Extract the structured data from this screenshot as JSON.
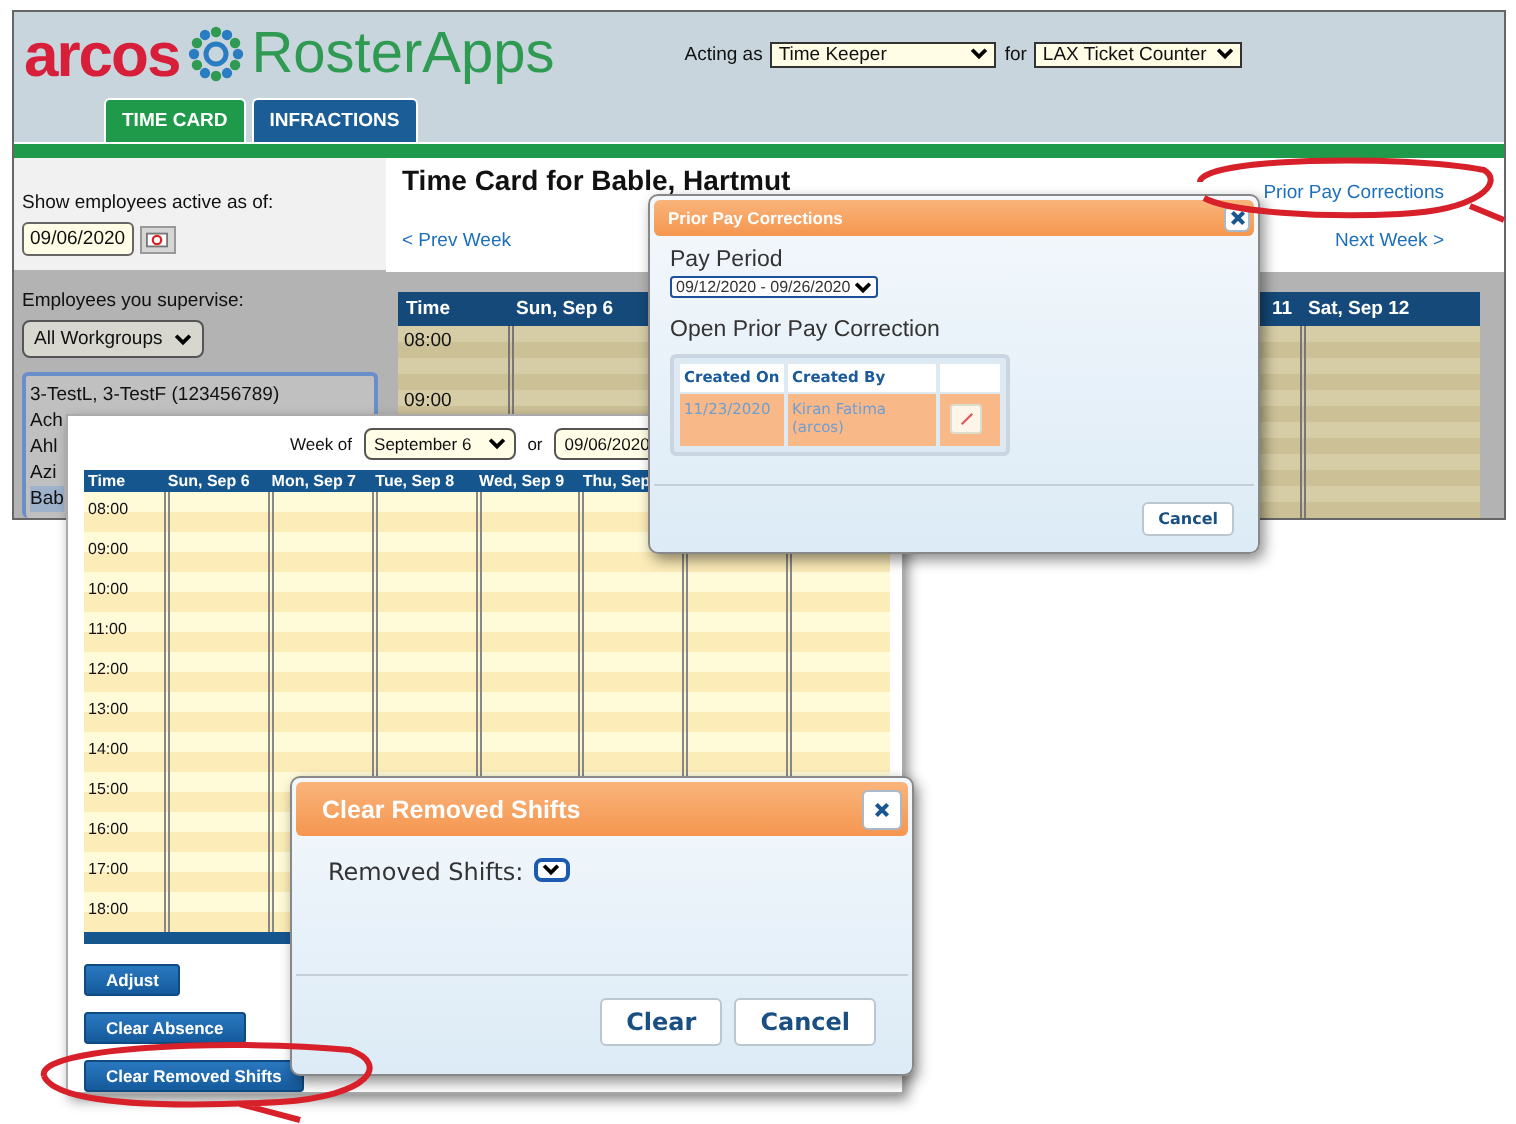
{
  "header": {
    "logo_word": "arcos",
    "logo_product": "RosterApps",
    "acting_as_label": "Acting as",
    "role": "Time Keeper",
    "for_label": "for",
    "location": "LAX Ticket Counter"
  },
  "tabs": [
    {
      "label": "TIME CARD",
      "selected": true
    },
    {
      "label": "INFRACTIONS",
      "selected": false
    }
  ],
  "sidebar": {
    "active_label": "Show employees active as of:",
    "active_date": "09/06/2020",
    "supervise_label": "Employees you supervise:",
    "workgroup": "All Workgroups",
    "employees": [
      {
        "name": "3-TestL, 3-TestF (123456789)",
        "selected": false
      },
      {
        "name": "Ach",
        "selected": false
      },
      {
        "name": "Ahl",
        "selected": false
      },
      {
        "name": "Azi",
        "selected": false
      },
      {
        "name": "Bab",
        "selected": true
      }
    ]
  },
  "time_card": {
    "title": "Time Card for Bable, Hartmut",
    "prev_link": "< Prev Week",
    "prior_link": "Prior Pay Corrections",
    "next_link": "Next Week >",
    "columns": [
      "Time",
      "Sun, Sep 6"
    ],
    "right_columns": [
      "11",
      "Sat, Sep 12"
    ],
    "hours": [
      "08:00",
      "09:00"
    ]
  },
  "week_view": {
    "week_of_label": "Week of",
    "week": "September 6",
    "or_label": "or",
    "date": "09/06/2020",
    "columns": [
      "Time",
      "Sun, Sep 6",
      "Mon, Sep 7",
      "Tue, Sep 8",
      "Wed, Sep 9",
      "Thu, Sep"
    ],
    "hours": [
      "08:00",
      "09:00",
      "10:00",
      "11:00",
      "12:00",
      "13:00",
      "14:00",
      "15:00",
      "16:00",
      "17:00",
      "18:00"
    ],
    "buttons": [
      "Adjust",
      "Clear Absence",
      "Clear Removed Shifts"
    ]
  },
  "prior_dialog": {
    "title": "Prior Pay Corrections",
    "pay_period_label": "Pay Period",
    "pay_period": "09/12/2020 - 09/26/2020",
    "open_label": "Open Prior Pay Correction",
    "columns": [
      "Created On",
      "Created By"
    ],
    "rows": [
      {
        "created_on": "11/23/2020",
        "created_by": "Kiran Fatima (arcos)",
        "selected": true
      }
    ],
    "cancel": "Cancel"
  },
  "clear_dialog": {
    "title": "Clear Removed Shifts",
    "field_label": "Removed Shifts:",
    "buttons": [
      "Clear",
      "Cancel"
    ]
  }
}
